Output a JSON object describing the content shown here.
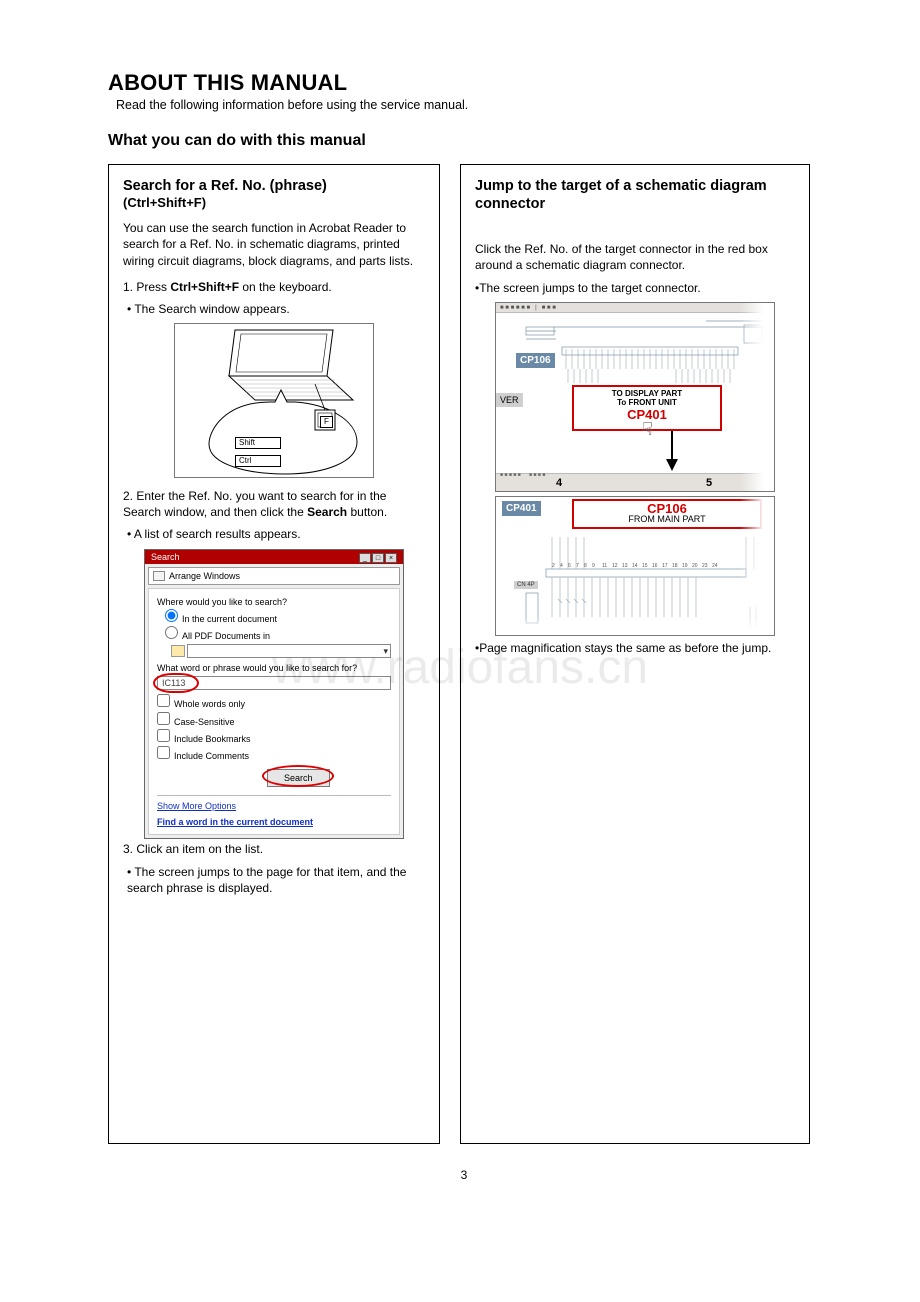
{
  "watermark": "www.radiofans.cn",
  "title": "ABOUT THIS MANUAL",
  "intro": "Read the following information before using the service manual.",
  "section_heading": "What you can do with this manual",
  "page_number": "3",
  "left": {
    "heading": "Search for a Ref. No. (phrase)",
    "shortcut": "(Ctrl+Shift+F)",
    "desc": "You can use the search function in Acrobat Reader to search for a Ref. No. in schematic diagrams, printed wiring circuit diagrams, block diagrams, and parts lists.",
    "step1_pre": "1. Press ",
    "step1_bold": "Ctrl+Shift+F",
    "step1_post": " on the keyboard.",
    "step1_sub": "•    The Search window appears.",
    "key_f": "F",
    "key_shift": "Shift",
    "key_ctrl": "Ctrl",
    "step2a": "2. Enter the Ref. No. you want to search for in the Search window, and then click the ",
    "step2b": "Search",
    "step2c": " button.",
    "step2_sub": "• A list of search results appears.",
    "searchwin": {
      "title": "Search",
      "arrange": "Arrange Windows",
      "q_where": "Where would you like to search?",
      "r1": "In the current document",
      "r2": "All PDF Documents in",
      "q_what": "What word or phrase would you like to search for?",
      "value": "IC113",
      "c1": "Whole words only",
      "c2": "Case-Sensitive",
      "c3": "Include Bookmarks",
      "c4": "Include Comments",
      "btn": "Search",
      "link1": "Show More Options",
      "link2": "Find a word in the current document"
    },
    "step3": "3. Click an item on the list.",
    "step3_sub": "• The screen jumps to the page for that item, and the search phrase is displayed."
  },
  "right": {
    "heading": "Jump to the target of a schematic diagram connector",
    "desc": "Click the Ref. No. of the target connector in the red box around a schematic diagram connector.",
    "desc_sub": "•The screen jumps to the target connector.",
    "cp106": "CP106",
    "cp401": "CP401",
    "ver": "VER",
    "to_display1": "TO DISPLAY PART",
    "to_display2": "To FRONT UNIT",
    "cp401_blue": "CP401",
    "cp106_blue": "CP106",
    "from_main": "FROM MAIN PART",
    "num4": "4",
    "num5": "5",
    "note": "•Page magnification stays the same as before the jump."
  }
}
